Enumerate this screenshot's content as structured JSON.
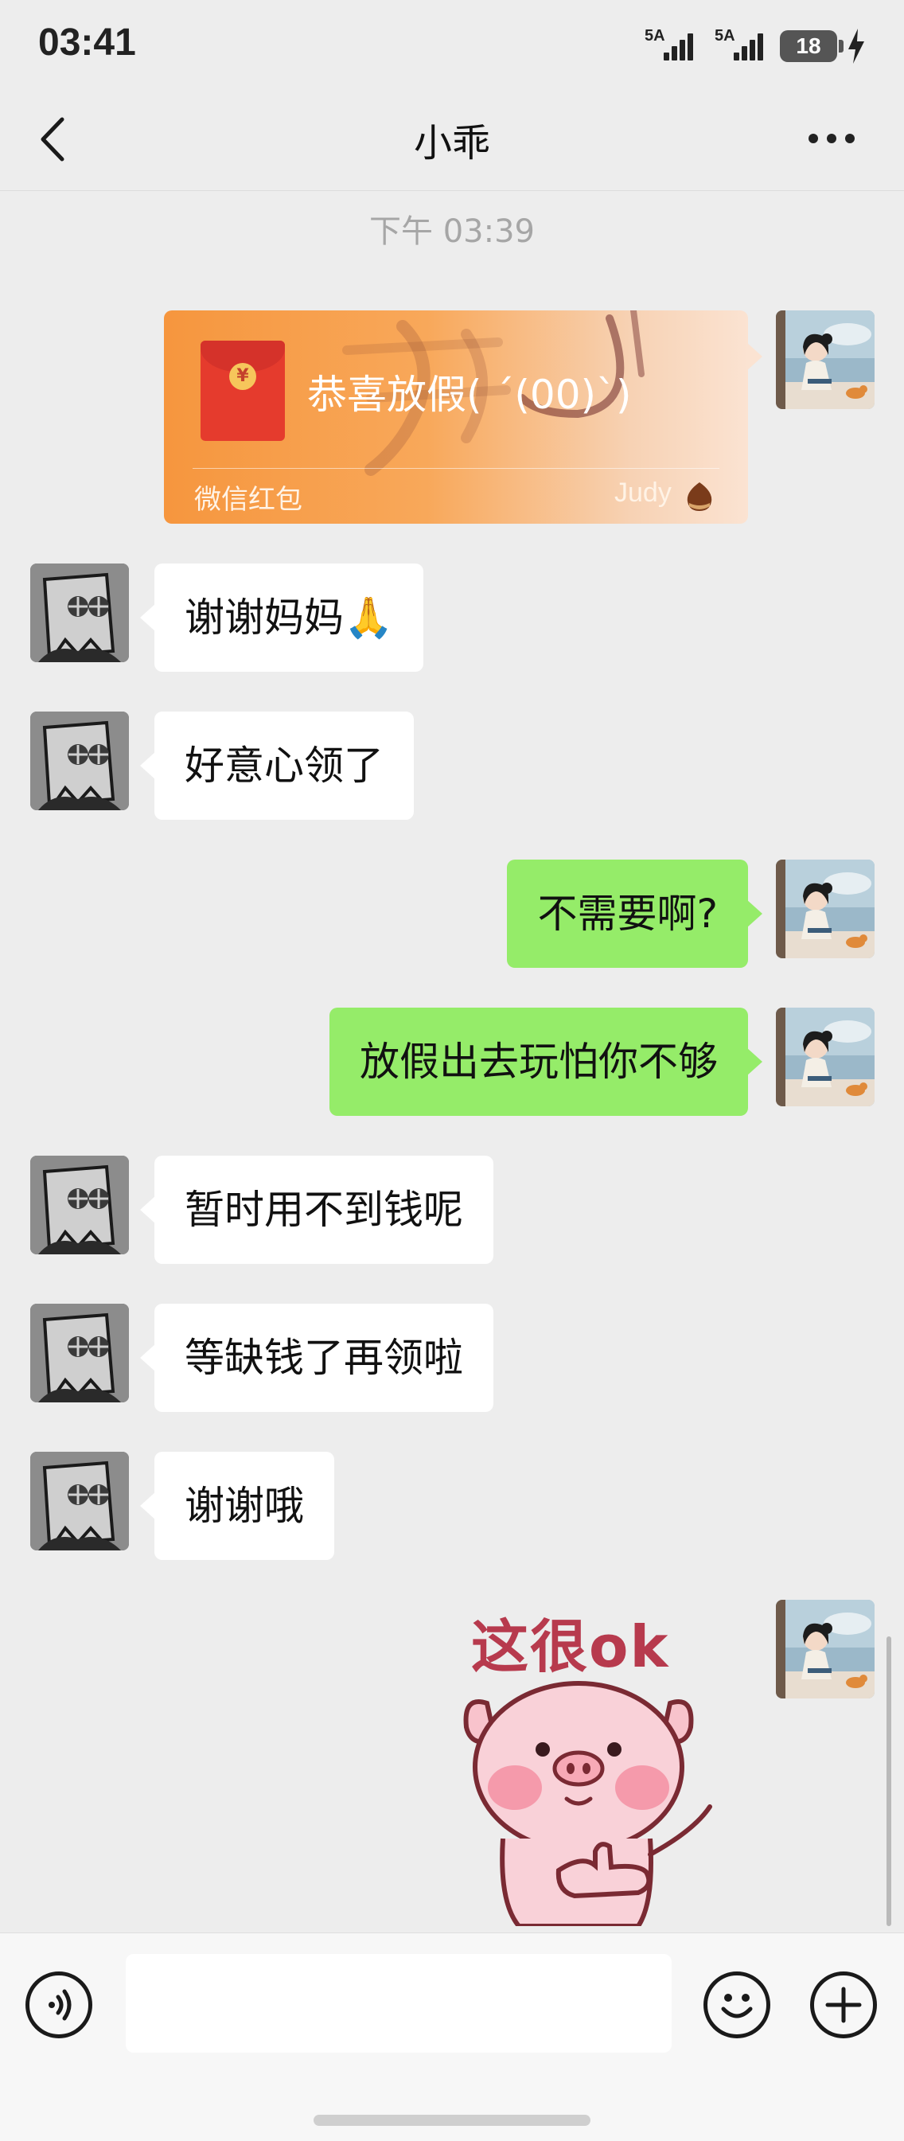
{
  "status_bar": {
    "time": "03:41",
    "signal_1_label": "5A",
    "signal_2_label": "5A",
    "battery_level": "18",
    "charging": true
  },
  "nav": {
    "title": "小乖",
    "back_icon": "chevron-left-icon",
    "more_icon": "more-dots-icon"
  },
  "chat": {
    "timestamp": "下午 03:39",
    "red_packet": {
      "title": "恭喜放假( ´(00)ˋ)",
      "label": "微信红包",
      "sender": "Judy"
    },
    "messages": [
      {
        "from": "contact",
        "text": "谢谢妈妈🙏"
      },
      {
        "from": "contact",
        "text": "好意心领了"
      },
      {
        "from": "me",
        "text": "不需要啊?"
      },
      {
        "from": "me",
        "text": "放假出去玩怕你不够"
      },
      {
        "from": "contact",
        "text": "暂时用不到钱呢"
      },
      {
        "from": "contact",
        "text": "等缺钱了再领啦"
      },
      {
        "from": "contact",
        "text": "谢谢哦"
      }
    ],
    "sticker": {
      "text": "这很ok",
      "description_icon": "pig-thumbs-up-sticker"
    }
  },
  "input_bar": {
    "voice_icon": "voice-icon",
    "emoji_icon": "emoji-icon",
    "add_icon": "plus-icon",
    "input_value": ""
  },
  "colors": {
    "background": "#ededed",
    "outgoing_bubble": "#95ec69",
    "incoming_bubble": "#ffffff",
    "red_packet": "#f6963e"
  }
}
